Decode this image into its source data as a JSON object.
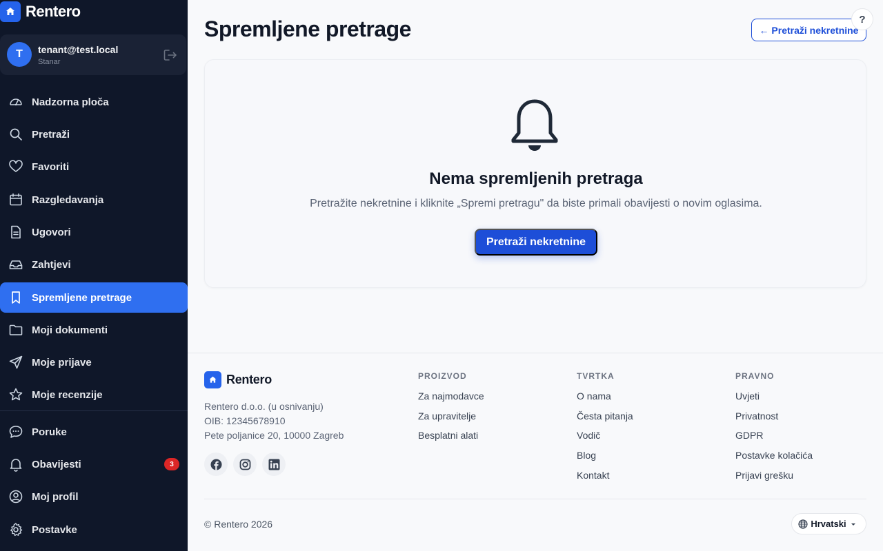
{
  "brand": {
    "name": "Rentero"
  },
  "user": {
    "initial": "T",
    "email": "tenant@test.local",
    "role": "Stanar"
  },
  "sidebar": {
    "items": [
      {
        "label": "Nadzorna ploča",
        "icon": "dashboard-icon"
      },
      {
        "label": "Pretraži",
        "icon": "search-icon"
      },
      {
        "label": "Favoriti",
        "icon": "heart-icon"
      },
      {
        "label": "Razgledavanja",
        "icon": "calendar-icon"
      },
      {
        "label": "Ugovori",
        "icon": "document-icon"
      },
      {
        "label": "Zahtjevi",
        "icon": "inbox-icon"
      },
      {
        "label": "Spremljene pretrage",
        "icon": "bookmark-icon",
        "active": true
      },
      {
        "label": "Moji dokumenti",
        "icon": "folder-icon"
      },
      {
        "label": "Moje prijave",
        "icon": "send-icon"
      },
      {
        "label": "Moje recenzije",
        "icon": "star-icon"
      }
    ],
    "bottom_items": [
      {
        "label": "Poruke",
        "icon": "chat-icon"
      },
      {
        "label": "Obavijesti",
        "icon": "bell-icon",
        "badge": "3"
      },
      {
        "label": "Moj profil",
        "icon": "user-circle-icon"
      },
      {
        "label": "Postavke",
        "icon": "gear-icon"
      }
    ]
  },
  "main": {
    "title": "Spremljene pretrage",
    "back_label": "← Pretraži nekretnine",
    "help_label": "?",
    "empty": {
      "title": "Nema spremljenih pretraga",
      "text": "Pretražite nekretnine i kliknite „Spremi pretragu\" da biste primali obavijesti o novim oglasima.",
      "button": "Pretraži nekretnine"
    }
  },
  "footer": {
    "brand": "Rentero",
    "company": "Rentero d.o.o. (u osnivanju)",
    "oib": "OIB: 12345678910",
    "address": "Pete poljanice 20, 10000 Zagreb",
    "columns": [
      {
        "heading": "PROIZVOD",
        "links": [
          "Za najmodavce",
          "Za upravitelje",
          "Besplatni alati"
        ]
      },
      {
        "heading": "TVRTKA",
        "links": [
          "O nama",
          "Česta pitanja",
          "Vodič",
          "Blog",
          "Kontakt"
        ]
      },
      {
        "heading": "PRAVNO",
        "links": [
          "Uvjeti",
          "Privatnost",
          "GDPR",
          "Postavke kolačića",
          "Prijavi grešku"
        ]
      }
    ],
    "copyright": "© Rentero 2026",
    "language": "Hrvatski"
  },
  "colors": {
    "sidebar_bg": "#0f1729",
    "accent": "#2f6ff0",
    "primary_button": "#1d4ed8",
    "badge": "#dc2626"
  }
}
